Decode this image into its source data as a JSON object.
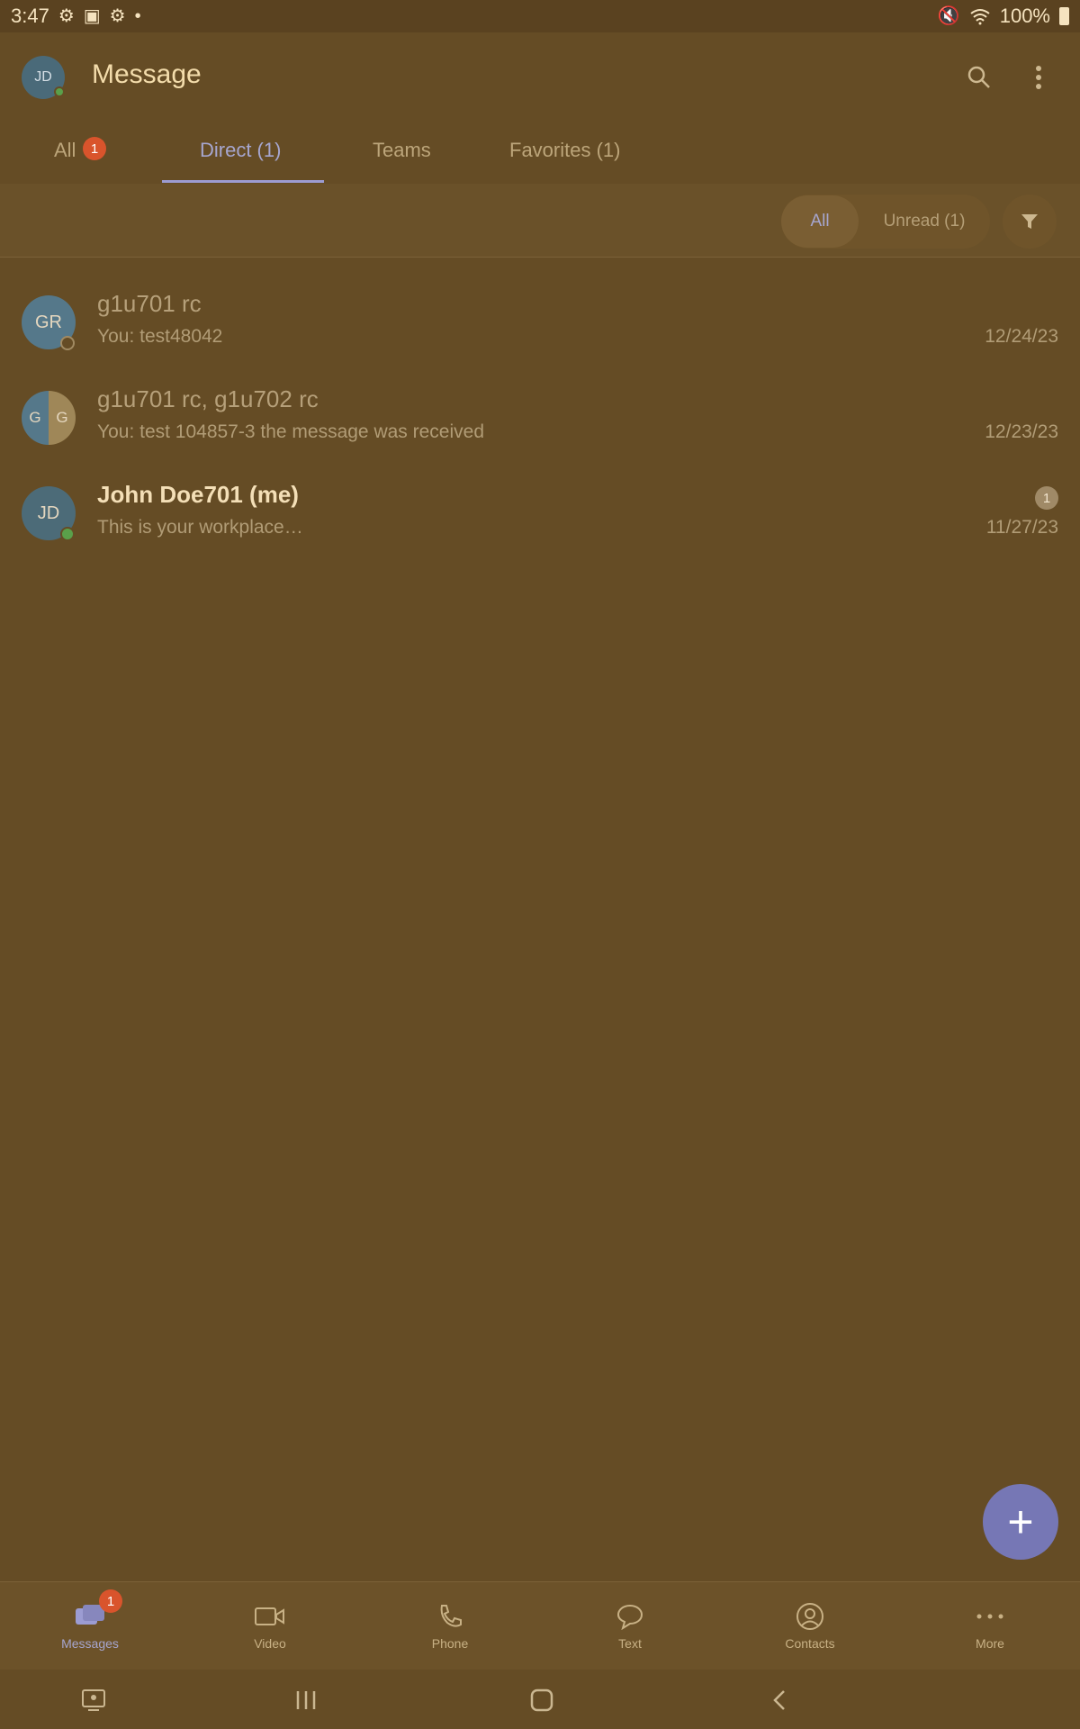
{
  "status_bar": {
    "time": "3:47",
    "battery": "100%",
    "icons": [
      "settings-icon",
      "image-icon",
      "gear-icon",
      "dot-icon",
      "mute-icon",
      "wifi-icon",
      "battery-icon"
    ]
  },
  "header": {
    "avatar_initials": "JD",
    "title": "Message"
  },
  "tabs": {
    "items": [
      {
        "label": "All",
        "badge": "1"
      },
      {
        "label": "Direct (1)"
      },
      {
        "label": "Teams"
      },
      {
        "label": "Favorites (1)"
      }
    ],
    "active_index": 1
  },
  "filter": {
    "all_label": "All",
    "unread_label": "Unread (1)"
  },
  "conversations": [
    {
      "initials": "GR",
      "name": "g1u701 rc",
      "preview": "You: test48042",
      "date": "12/24/23"
    },
    {
      "initials_left": "G",
      "initials_right": "G",
      "name": "g1u701 rc, g1u702 rc",
      "preview": "You: test 104857-3 the message was received",
      "date": "12/23/23"
    },
    {
      "initials": "JD",
      "name": "John Doe701 (me)",
      "preview": "This is your workplace…",
      "date": "11/27/23",
      "unread": "1"
    }
  ],
  "fab": {
    "label": "+"
  },
  "bottom_nav": {
    "items": [
      {
        "label": "Messages",
        "badge": "1"
      },
      {
        "label": "Video"
      },
      {
        "label": "Phone"
      },
      {
        "label": "Text"
      },
      {
        "label": "Contacts"
      },
      {
        "label": "More"
      }
    ]
  },
  "colors": {
    "background": "#654c25",
    "accent": "#7677b5",
    "badge": "#d9542c"
  }
}
